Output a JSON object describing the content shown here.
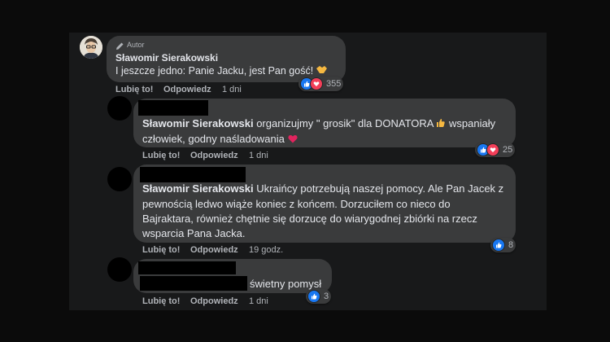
{
  "author_badge": "Autor",
  "actions": {
    "like": "Lubię to!",
    "reply": "Odpowiedz"
  },
  "comments": [
    {
      "name": "Sławomir Sierakowski",
      "text": "I jeszcze jedno: Panie Jacku, jest Pan gość!",
      "time": "1 dni",
      "reactions": {
        "count": "355",
        "types": [
          "like",
          "love"
        ]
      }
    },
    {
      "mention": "Sławomir Sierakowski",
      "text_line1": "organizujmy \" grosik\" dla DONATORA",
      "text_line1_tail": "wspaniały",
      "text_line2": "człowiek, godny naśladowania",
      "time": "1 dni",
      "reactions": {
        "count": "25",
        "types": [
          "like",
          "love"
        ]
      }
    },
    {
      "mention": "Sławomir Sierakowski",
      "text_line1": "Ukraińcy potrzebują naszej pomocy. Ale Pan Jacek z",
      "text_line2": "pewnością ledwo wiąże koniec z końcem. Dorzuciłem co nieco do",
      "text_line3": "Bajraktara, również chętnie się dorzucę do wiarygodnej zbiórki na rzecz",
      "text_line4": "wsparcia Pana Jacka.",
      "time": "19 godz.",
      "reactions": {
        "count": "8",
        "types": [
          "like"
        ]
      }
    },
    {
      "text": "świetny pomysł",
      "time": "1 dni",
      "reactions": {
        "count": "3",
        "types": [
          "like"
        ]
      }
    }
  ],
  "colors": {
    "like": "#1877f2",
    "love": "#f33e58",
    "bubble": "#3a3b3c",
    "name": "#e4e6eb"
  }
}
